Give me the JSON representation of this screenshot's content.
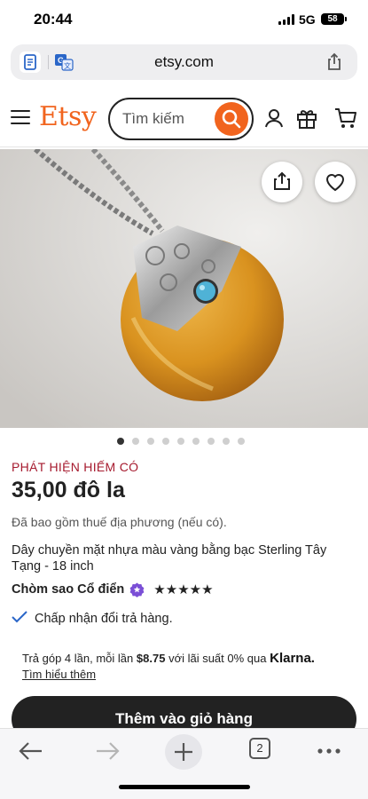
{
  "status_bar": {
    "time": "20:44",
    "network": "5G",
    "battery": "58"
  },
  "browser": {
    "url": "etsy.com",
    "tab_count": "2"
  },
  "header": {
    "logo": "Etsy",
    "search_placeholder": "Tìm kiếm"
  },
  "carousel": {
    "total": 9,
    "active": 0
  },
  "product": {
    "badge": "PHÁT HIỆN HIẾM CÓ",
    "price": "35,00 đô la",
    "tax_note": "Đã bao gồm thuế địa phương (nếu có).",
    "title": "Dây chuyền mặt nhựa màu vàng bằng bạc Sterling Tây Tạng - 18 inch",
    "shop_name": "Chòm sao Cổ điển",
    "rating": 5,
    "stars": "★★★★★",
    "returns": "Chấp nhận đổi trả hàng.",
    "klarna_prefix": "Trả góp 4 lần, mỗi lần",
    "klarna_amount": "$8.75",
    "klarna_suffix": "với lãi suất 0% qua",
    "klarna_brand": "Klarna.",
    "learn_more": "Tìm hiểu thêm",
    "add_to_cart": "Thêm vào giỏ hàng"
  },
  "colors": {
    "etsy_orange": "#f1641e",
    "rare_find_red": "#a61a2e",
    "star_seller_purple": "#7b4fd6",
    "check_blue": "#2a66c8"
  }
}
